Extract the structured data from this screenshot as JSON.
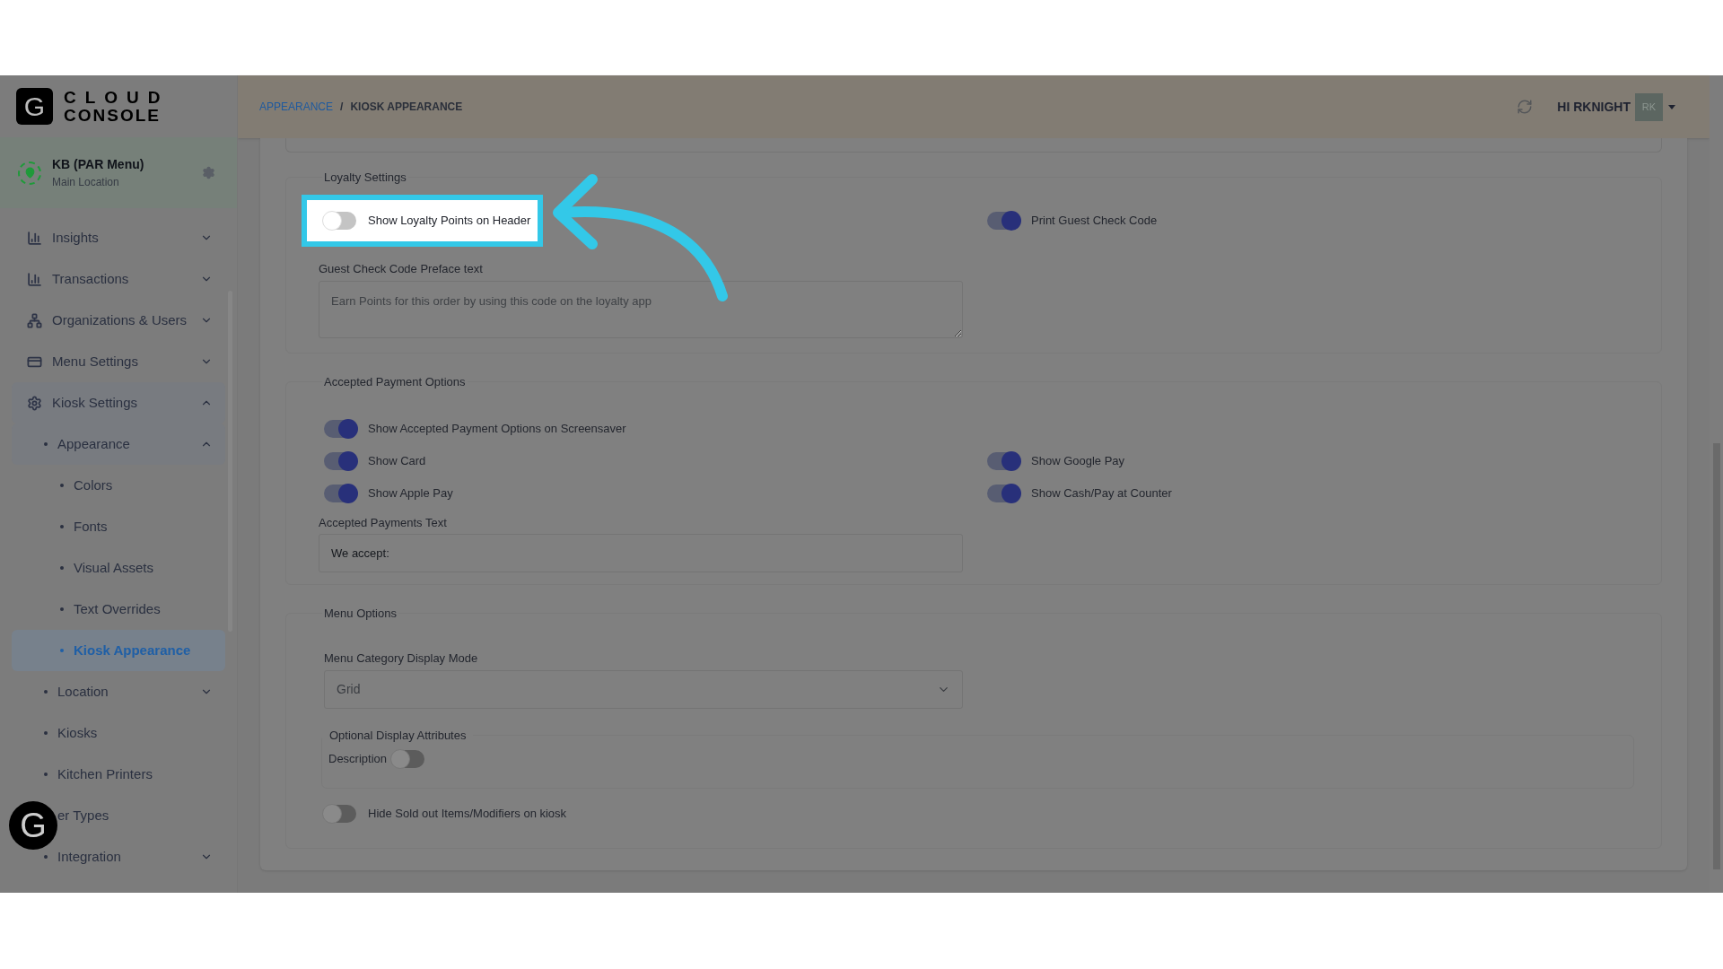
{
  "logo": {
    "mark": "G",
    "line1": "CLOUD",
    "line2": "CONSOLE"
  },
  "location": {
    "name": "KB (PAR Menu)",
    "subtitle": "Main Location"
  },
  "sidebar": {
    "items": [
      {
        "label": "Insights",
        "expanded": false,
        "selected": false
      },
      {
        "label": "Transactions",
        "expanded": false,
        "selected": false
      },
      {
        "label": "Organizations & Users",
        "expanded": false,
        "selected": false
      },
      {
        "label": "Menu Settings",
        "expanded": false,
        "selected": false
      },
      {
        "label": "Kiosk Settings",
        "expanded": true,
        "selected": false,
        "children": [
          {
            "label": "Appearance",
            "expanded": true,
            "selected": false,
            "children": [
              {
                "label": "Colors",
                "selected": false
              },
              {
                "label": "Fonts",
                "selected": false
              },
              {
                "label": "Visual Assets",
                "selected": false
              },
              {
                "label": "Text Overrides",
                "selected": false
              },
              {
                "label": "Kiosk Appearance",
                "selected": true
              }
            ]
          },
          {
            "label": "Location",
            "expanded": false,
            "selected": false
          },
          {
            "label": "Kiosks",
            "selected": false
          },
          {
            "label": "Kitchen Printers",
            "selected": false
          },
          {
            "label": "er Types",
            "selected": false
          },
          {
            "label": "Integration",
            "expanded": false,
            "selected": false
          }
        ]
      }
    ]
  },
  "header": {
    "breadcrumb": [
      {
        "label": "APPEARANCE",
        "link": true
      },
      {
        "label": "KIOSK APPEARANCE",
        "link": false
      }
    ],
    "separator": "/",
    "greeting": "HI RKNIGHT",
    "avatar": "RK"
  },
  "loyalty": {
    "title": "Loyalty Settings",
    "rows": [
      [
        {
          "label": "Show Loyalty Points on Header",
          "on": false,
          "highlighted": true
        },
        {
          "label": "Print Guest Check Code",
          "on": true,
          "highlighted": false
        }
      ]
    ],
    "field": {
      "label": "Guest Check Code Preface text",
      "placeholder": "Earn Points for this order by using this code on the loyalty app"
    }
  },
  "payment": {
    "title": "Accepted Payment Options",
    "rows": [
      [
        {
          "label": "Show Accepted Payment Options on Screensaver",
          "on": true,
          "highlighted": false
        }
      ],
      [
        {
          "label": "Show Card",
          "on": true,
          "highlighted": false
        },
        {
          "label": "Show Google Pay",
          "on": true,
          "highlighted": false
        }
      ],
      [
        {
          "label": "Show Apple Pay",
          "on": true,
          "highlighted": false
        },
        {
          "label": "Show Cash/Pay at Counter",
          "on": true,
          "highlighted": false
        }
      ]
    ],
    "field": {
      "label": "Accepted Payments Text",
      "value": "We accept:"
    }
  },
  "floating_button": {
    "mark": "G"
  },
  "menu": {
    "title": "Menu Options",
    "select": {
      "label": "Menu Category Display Mode",
      "value": "Grid"
    },
    "attributes": {
      "title": "Optional Display Attributes",
      "items": [
        {
          "label": "Description",
          "on": false
        }
      ]
    },
    "toggles": [
      {
        "label": "Hide Sold out Items/Modifiers on kiosk",
        "on": false
      }
    ]
  }
}
